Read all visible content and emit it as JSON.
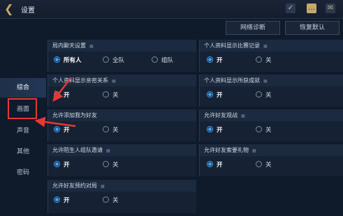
{
  "header": {
    "title": "设置"
  },
  "actions": {
    "diagnose": "网络诊断",
    "reset": "恢复默认"
  },
  "sidebar": {
    "items": [
      {
        "label": "综合",
        "active": true
      },
      {
        "label": "画面",
        "active": false
      },
      {
        "label": "声音",
        "active": false
      },
      {
        "label": "其他",
        "active": false
      },
      {
        "label": "密码",
        "active": false
      }
    ]
  },
  "panels": {
    "chat": {
      "title": "局内聊天设置",
      "options": [
        "所有人",
        "全队",
        "组队"
      ],
      "selected": 0
    },
    "show_match": {
      "title": "个人资料显示比赛记录",
      "options": [
        "开",
        "关"
      ],
      "selected": 0
    },
    "show_intimacy": {
      "title": "个人资料显示亲密关系",
      "options": [
        "开",
        "关"
      ],
      "selected": 0
    },
    "show_achievements": {
      "title": "个人资料显示所获成就",
      "options": [
        "开",
        "关"
      ],
      "selected": 0
    },
    "allow_friend": {
      "title": "允许添加我为好友",
      "options": [
        "开",
        "关"
      ],
      "selected": 0
    },
    "friend_spectate": {
      "title": "允许好友观战",
      "options": [
        "开",
        "关"
      ],
      "selected": 0
    },
    "stranger_invite": {
      "title": "允许陌生人组队邀请",
      "options": [
        "开",
        "关"
      ],
      "selected": 0
    },
    "friend_gift": {
      "title": "允许好友索要礼物",
      "options": [
        "开",
        "关"
      ],
      "selected": 0
    },
    "friend_schedule": {
      "title": "允许好友预约对局",
      "options": [
        "开",
        "关"
      ],
      "selected": 0
    }
  },
  "colors": {
    "accent": "#3fa8ff",
    "highlight": "#e53935",
    "gold": "#c6a86a"
  }
}
